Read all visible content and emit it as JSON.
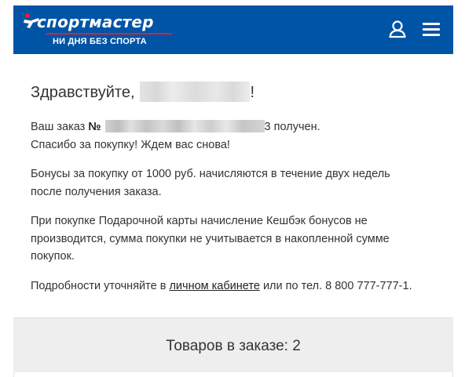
{
  "header": {
    "logo_text": "спортмастер",
    "tagline": "НИ ДНЯ БЕЗ СПОРТА",
    "background_color": "#0054a6",
    "accent_color": "#e41f2c",
    "user_icon": "user-icon",
    "menu_icon": "hamburger-menu-icon"
  },
  "greeting": {
    "prefix": "Здравствуйте,",
    "suffix": "!"
  },
  "order": {
    "prefix": "Ваш заказ",
    "number_sign": "№",
    "number_tail": "3",
    "status": "получен.",
    "thanks": "Спасибо за покупку! Ждем вас снова!"
  },
  "bonus_note": "Бонусы за покупку от 1000 руб. начисляются в течение двух недель после получения заказа.",
  "gift_card_note": "При покупке Подарочной карты начисление Кешбэк бонусов не производится, сумма покупки не учитывается в накопленной сумме покупок.",
  "details": {
    "prefix": "Подробности уточняйте в",
    "link_text": "личном кабинете",
    "suffix": "или по тел. 8 800 777-777-1."
  },
  "order_summary": {
    "title": "Товаров в заказе: 2"
  }
}
